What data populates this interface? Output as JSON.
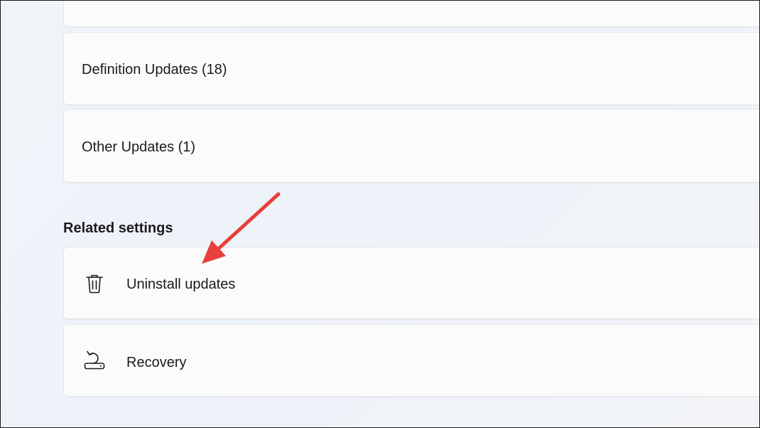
{
  "updates": {
    "items": [
      {
        "label": ""
      },
      {
        "label": "Definition Updates (18)"
      },
      {
        "label": "Other Updates (1)"
      }
    ]
  },
  "related_settings": {
    "title": "Related settings",
    "items": [
      {
        "label": "Uninstall updates",
        "icon": "trash-icon"
      },
      {
        "label": "Recovery",
        "icon": "recovery-icon"
      }
    ]
  },
  "annotation": {
    "arrow_color": "#e8403a",
    "icon": "arrow-icon"
  },
  "colors": {
    "card_background": "#fbfbfb",
    "card_border": "#e3e5e9",
    "page_background": "#f1f4f9",
    "text": "#1b1b1b"
  }
}
